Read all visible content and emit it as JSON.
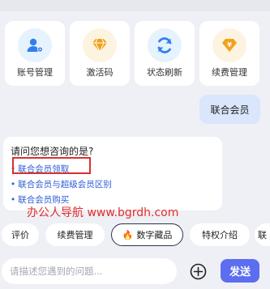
{
  "quick_actions": [
    {
      "label": "账号管理",
      "icon": "user-settings-icon",
      "color": "#2f80ed",
      "bg": "#e6f2fd"
    },
    {
      "label": "激活码",
      "icon": "diamond-icon",
      "color": "#f0a21a",
      "bg": "#fdf3e1"
    },
    {
      "label": "状态刷新",
      "icon": "refresh-icon",
      "color": "#2f80ed",
      "bg": "#e6f2fd"
    },
    {
      "label": "续费管理",
      "icon": "yen-diamond-icon",
      "color": "#f0a21a",
      "bg": "#fdf3e1"
    }
  ],
  "chat": {
    "user_message": "联合会员",
    "bot_question": "请问您想咨询的是?",
    "options": [
      "联合会员领取",
      "联合会员与超级会员区别",
      "联合会员购买"
    ]
  },
  "watermark": "办公人导航 www.bgrdh.com",
  "chips": [
    {
      "label": "评价",
      "icon": ""
    },
    {
      "label": "续费管理",
      "icon": ""
    },
    {
      "label": "数字藏品",
      "icon": "fire-icon"
    },
    {
      "label": "特权介绍",
      "icon": ""
    },
    {
      "label": "联",
      "icon": ""
    }
  ],
  "composer": {
    "placeholder": "请描述您遇到的问题...",
    "send_label": "发送"
  },
  "colors": {
    "accent": "#5b6ef0",
    "link": "#2d5bd6",
    "highlight": "#d93030"
  }
}
